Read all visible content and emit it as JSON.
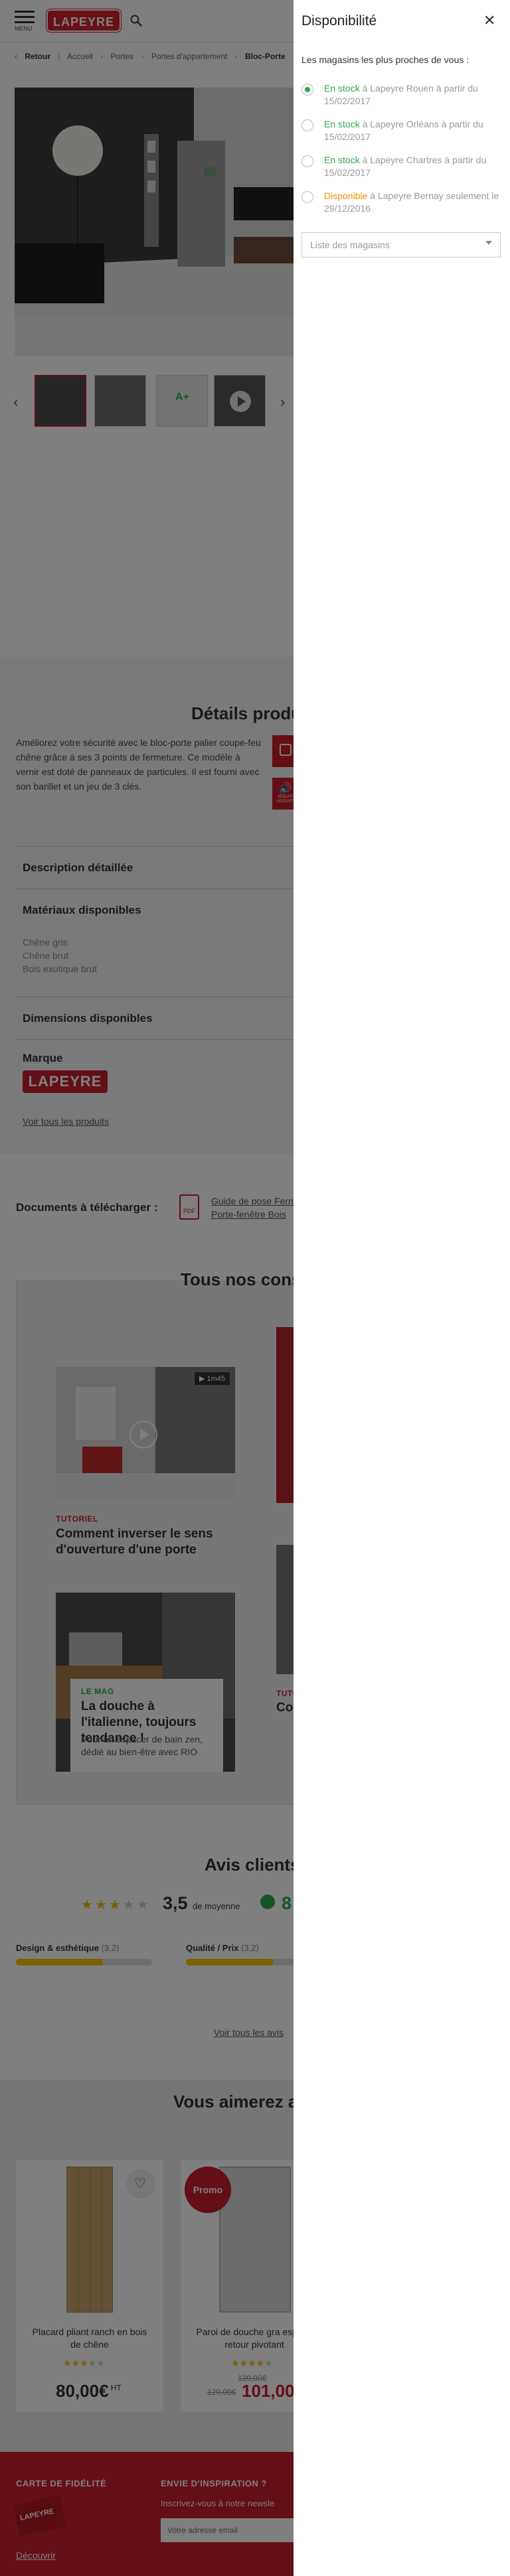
{
  "header": {
    "menu_label": "MENU",
    "logo_text": "LAPEYRE"
  },
  "breadcrumb": {
    "back": "Retour",
    "items": [
      "Accueil",
      "Portes",
      "Portes d'appartement"
    ],
    "current": "Bloc-Porte"
  },
  "gallery": {
    "thumb_badge": "A+"
  },
  "details": {
    "title": "Détails produ",
    "description": "Améliorez votre sécurité avec le bloc-porte palier coupe-feu chêne grâce à ses 3 points de fermeture. Ce modèle à vernir est doté de panneaux de particules. Il est fourni avec son barillet et un jeu de 3 clés.",
    "badge_label": "ISOLATI ACOUSTI",
    "accordion": {
      "description": "Description détaillée",
      "materials": "Matériaux disponibles",
      "dimensions": "Dimensions disponibles",
      "brand": "Marque"
    },
    "materials": [
      "Chêne gris",
      "Chêne brut",
      "Bois exotique brut"
    ],
    "brand_logo": "LAPEYRE",
    "all_products_link": "Voir tous les produits"
  },
  "documents": {
    "label": "Documents à télécharger :",
    "pdf_label": "PDF",
    "links": [
      "Guide de pose Fern",
      "Porte-fenêtre Bois"
    ]
  },
  "inspiration": {
    "title": "Tous nos cons",
    "video_duration": "1m45",
    "cards": [
      {
        "tag": "TUTORIEL",
        "title": "Comment inverser le sens d'ouverture  d'une porte"
      },
      {
        "tag": "LE MAG",
        "title": "La douche à l'italienne, toujours tendance !",
        "subtitle": "Pour un espacer de bain zen, dédié au bien-être avec RIO"
      }
    ],
    "partial_tag": "TUTO",
    "partial_title": "Com d'ou"
  },
  "reviews": {
    "title": "Avis clients",
    "rating": "3,5",
    "rating_suffix": "de moyenne",
    "partial_number": "8",
    "criteria": [
      {
        "label": "Design & esthétique",
        "score": "(3,2)",
        "fill": 0.64
      },
      {
        "label": "Qualité / Prix",
        "score": "(3,2)",
        "fill": 0.64
      }
    ],
    "all_reviews_link": "Voir tous les avis",
    "stars_filled": 3,
    "stars_total": 5
  },
  "also_like": {
    "title": "Vous aimerez a",
    "products": [
      {
        "name": "Placard pliant ranch en bois de chêne",
        "price": "80,00€",
        "price_suffix": "HT",
        "stars_filled": 3
      },
      {
        "name": "Paroi de douche gra espace retour pivotant",
        "old_price": "120,00€",
        "price": "101,00",
        "promo": "Promo",
        "stars_filled": 4
      }
    ]
  },
  "footer": {
    "loyalty_title": "CARTE DE FIDÉLITÉ",
    "loyalty_link": "Découvrir",
    "card_logo": "LAPEYRE",
    "newsletter_title": "ENVIE D'INSPIRATION ?",
    "newsletter_text": "Inscrivez-vous à notre newsle",
    "email_placeholder": "Votre adresse email"
  },
  "drawer": {
    "title": "Disponibilité",
    "intro": "Les magasins les plus proches de vous :",
    "stores": [
      {
        "status": "En stock",
        "text": " à Lapeyre Rouen à partir du 15/02/2017",
        "color": "#2ea84a",
        "selected": true
      },
      {
        "status": "En stock",
        "text": " à Lapeyre Orléans à partir du 15/02/2017",
        "color": "#2ea84a",
        "selected": false
      },
      {
        "status": "En stock",
        "text": " à Lapeyre Chartres à partir du 15/02/2017",
        "color": "#2ea84a",
        "selected": false
      },
      {
        "status": "Disponible",
        "text": " à Lapeyre Bernay seulement le 29/12/2016",
        "color": "#f39200",
        "selected": false
      }
    ],
    "select_label": "Liste des magasins"
  },
  "colors": {
    "brand_red": "#c81e2e",
    "in_stock_green": "#2ea84a",
    "available_orange": "#f39200",
    "star_yellow": "#f2c200"
  }
}
